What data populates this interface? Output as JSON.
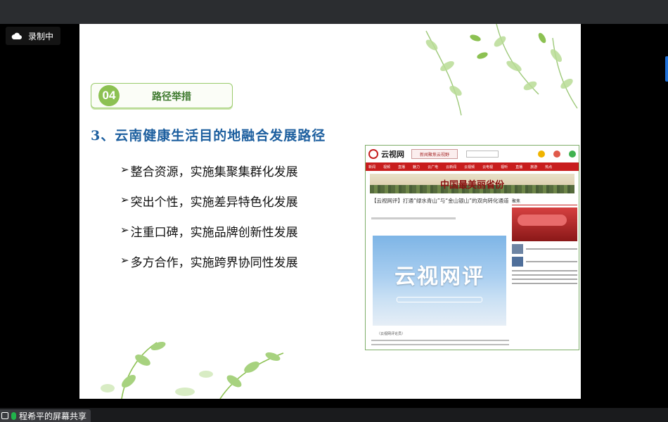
{
  "recording": {
    "label": "录制中"
  },
  "slide": {
    "section_number": "04",
    "section_title": "路径举措",
    "subtitle": "3、云南健康生活目的地融合发展路径",
    "bullets": [
      "整合资源，实施集聚集群化发展",
      "突出个性，实施差异特色化发展",
      "注重口碑，实施品牌创新性发展",
      "多方合作，实施跨界协同性发展"
    ],
    "bullet_marker": "➢"
  },
  "news": {
    "logo": "云视网",
    "slogan": "新闻聚焦云视野",
    "nav": [
      "新闻",
      "视频",
      "直播",
      "魅力",
      "云广电",
      "云新闻",
      "云视频",
      "云电视",
      "视听",
      "直播",
      "旅游",
      "热点"
    ],
    "banner": "中国最美丽省份",
    "article_title": "【云视网评】打通“绿水青山”与“金山银山”的双向转化通道",
    "image_text": "云视网评",
    "caption": "（云视网评论员）",
    "side_title": "聚焦"
  },
  "share": {
    "label": "程希平的屏幕共享"
  },
  "colors": {
    "accent_green": "#8cc152",
    "title_blue": "#1d5f9f",
    "news_red": "#c81d1d",
    "mic_green": "#21b34b"
  }
}
